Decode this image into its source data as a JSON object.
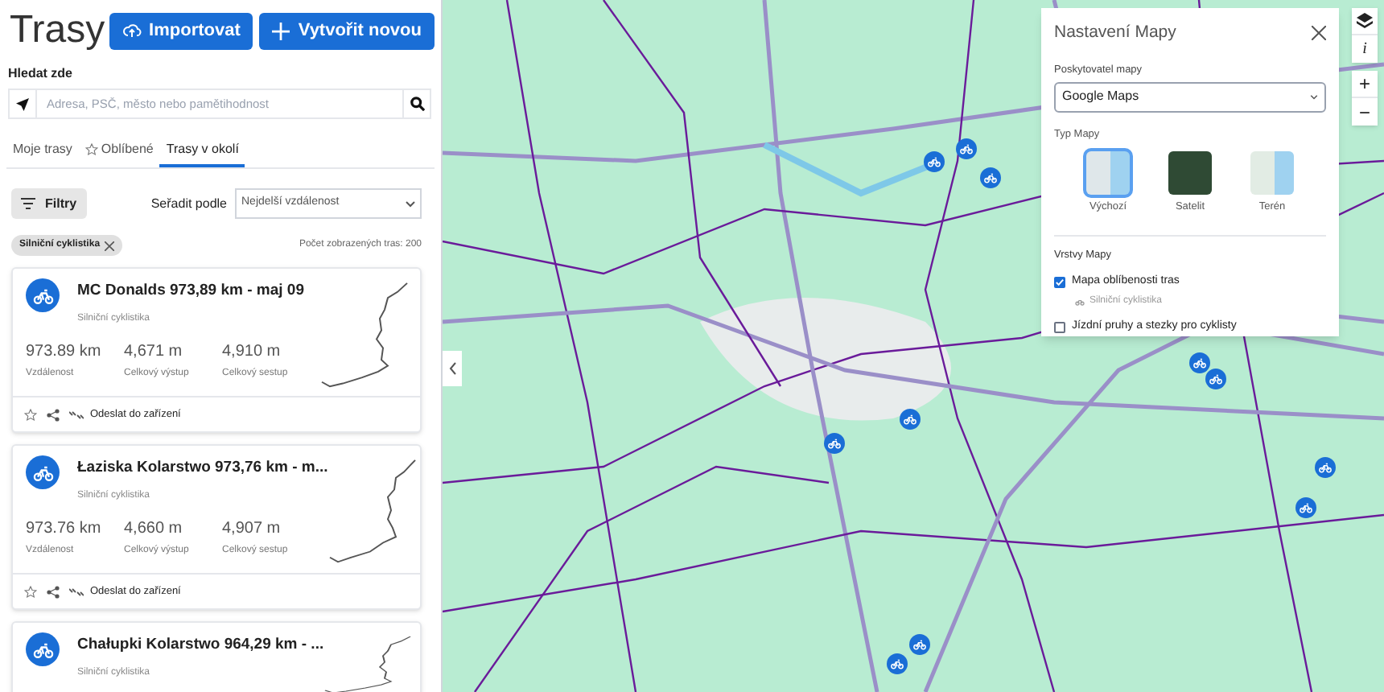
{
  "header": {
    "title": "Trasy",
    "buttons": [
      {
        "kind": "import",
        "label": "Importovat"
      },
      {
        "kind": "create",
        "label": "Vytvořit novou"
      }
    ]
  },
  "search": {
    "label": "Hledat zde",
    "placeholder": "Adresa, PSČ, město nebo pamětihodnost"
  },
  "tabs": [
    {
      "label": "Moje trasy",
      "selected": false,
      "kind": "plain"
    },
    {
      "label": "Oblíbené",
      "selected": false,
      "kind": "star"
    },
    {
      "label": "Trasy v okolí",
      "selected": true,
      "kind": "plain"
    }
  ],
  "filters": {
    "button": "Filtry",
    "sort_label": "Seřadit podle",
    "sort_value": "Nejdelší vzdálenost",
    "chip": "Silniční cyklistika",
    "count": "Počet zobrazených tras: 200"
  },
  "routes": [
    {
      "title": "MC Donalds 973,89 km - maj 09",
      "type": "Silniční cyklistika",
      "stats": [
        {
          "value": "973.89 km",
          "label": "Vzdálenost"
        },
        {
          "value": "4,671 m",
          "label": "Celkový výstup"
        },
        {
          "value": "4,910 m",
          "label": "Celkový sestup"
        }
      ],
      "favorite": false,
      "send": "Odeslat do zařízení"
    },
    {
      "title": "Łaziska Kolarstwo 973,76 km - m...",
      "type": "Silniční cyklistika",
      "stats": [
        {
          "value": "973.76 km",
          "label": "Vzdálenost"
        },
        {
          "value": "4,660 m",
          "label": "Celkový výstup"
        },
        {
          "value": "4,907 m",
          "label": "Celkový sestup"
        }
      ],
      "favorite": false,
      "send": "Odeslat do zařízení"
    },
    {
      "title": "Chałupki Kolarstwo 964,29 km - ...",
      "type": "Silniční cyklistika"
    }
  ],
  "map_settings": {
    "title": "Nastavení Mapy",
    "provider_label": "Poskytovatel mapy",
    "provider": "Google Maps",
    "type_label": "Typ Mapy",
    "map_types": [
      {
        "label": "Výchozí",
        "kind": "default",
        "selected": true
      },
      {
        "label": "Satelit",
        "kind": "satellite",
        "selected": false
      },
      {
        "label": "Terén",
        "kind": "terrain",
        "selected": false
      }
    ],
    "layers_label": "Vrstvy Mapy",
    "layers": [
      {
        "label": "Mapa oblíbenosti tras",
        "checked": true,
        "sub": "Silniční cyklistika"
      },
      {
        "label": "Jízdní pruhy a stezky pro cyklisty",
        "checked": false
      }
    ]
  },
  "map_controls": {
    "info": "i",
    "zoom_in": "+",
    "zoom_out": "−"
  }
}
